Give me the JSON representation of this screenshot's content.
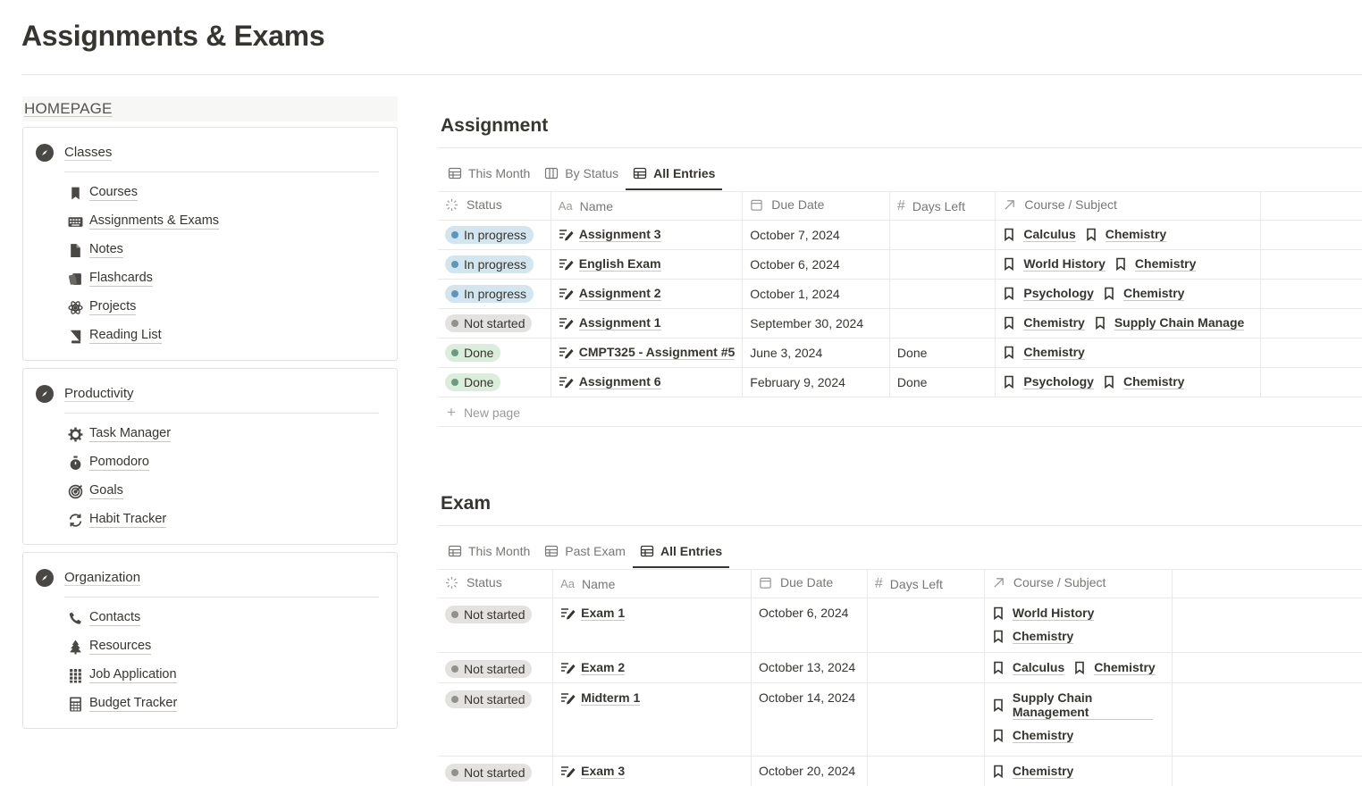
{
  "page": {
    "title": "Assignments & Exams"
  },
  "sidebar": {
    "homepage_label": "HOMEPAGE",
    "sections": [
      {
        "title": "Classes",
        "items": [
          {
            "label": "Courses",
            "icon": "bookmark-icon"
          },
          {
            "label": "Assignments & Exams",
            "icon": "keyboard-icon"
          },
          {
            "label": "Notes",
            "icon": "document-icon"
          },
          {
            "label": "Flashcards",
            "icon": "cards-icon"
          },
          {
            "label": "Projects",
            "icon": "atom-icon"
          },
          {
            "label": "Reading List",
            "icon": "book-icon"
          }
        ]
      },
      {
        "title": "Productivity",
        "items": [
          {
            "label": "Task Manager",
            "icon": "gear-icon"
          },
          {
            "label": "Pomodoro",
            "icon": "stopwatch-icon"
          },
          {
            "label": "Goals",
            "icon": "target-icon"
          },
          {
            "label": "Habit Tracker",
            "icon": "refresh-icon"
          }
        ]
      },
      {
        "title": "Organization",
        "items": [
          {
            "label": "Contacts",
            "icon": "phone-icon"
          },
          {
            "label": "Resources",
            "icon": "tree-icon"
          },
          {
            "label": "Job Application",
            "icon": "grid-icon"
          },
          {
            "label": "Budget Tracker",
            "icon": "calculator-icon"
          }
        ]
      }
    ]
  },
  "assignment": {
    "title": "Assignment",
    "tabs": [
      "This Month",
      "By Status",
      "All Entries"
    ],
    "active_tab": "All Entries",
    "columns": [
      "Status",
      "Name",
      "Due Date",
      "Days Left",
      "Course / Subject"
    ],
    "rows": [
      {
        "status": "In progress",
        "name": "Assignment 3",
        "due": "October 7, 2024",
        "days_left": "",
        "courses": [
          "Calculus",
          "Chemistry"
        ]
      },
      {
        "status": "In progress",
        "name": "English Exam",
        "due": "October 6, 2024",
        "days_left": "",
        "courses": [
          "World History",
          "Chemistry"
        ]
      },
      {
        "status": "In progress",
        "name": "Assignment 2",
        "due": "October 1, 2024",
        "days_left": "",
        "courses": [
          "Psychology",
          "Chemistry"
        ]
      },
      {
        "status": "Not started",
        "name": "Assignment 1",
        "due": "September 30, 2024",
        "days_left": "",
        "courses": [
          "Chemistry",
          "Supply Chain Manage"
        ]
      },
      {
        "status": "Done",
        "name": "CMPT325 - Assignment #5",
        "due": "June 3, 2024",
        "days_left": "Done",
        "courses": [
          "Chemistry"
        ]
      },
      {
        "status": "Done",
        "name": "Assignment 6",
        "due": "February 9, 2024",
        "days_left": "Done",
        "courses": [
          "Psychology",
          "Chemistry"
        ]
      }
    ],
    "new_page_label": "New page"
  },
  "exam": {
    "title": "Exam",
    "tabs": [
      "This Month",
      "Past Exam",
      "All Entries"
    ],
    "active_tab": "All Entries",
    "columns": [
      "Status",
      "Name",
      "Due Date",
      "Days Left",
      "Course / Subject"
    ],
    "rows": [
      {
        "status": "Not started",
        "name": "Exam 1",
        "due": "October 6, 2024",
        "days_left": "",
        "courses": [
          "World History",
          "Chemistry"
        ]
      },
      {
        "status": "Not started",
        "name": "Exam 2",
        "due": "October 13, 2024",
        "days_left": "",
        "courses": [
          "Calculus",
          "Chemistry"
        ]
      },
      {
        "status": "Not started",
        "name": "Midterm 1",
        "due": "October 14, 2024",
        "days_left": "",
        "courses": [
          "Supply Chain Management",
          "Chemistry"
        ]
      },
      {
        "status": "Not started",
        "name": "Exam 3",
        "due": "October 20, 2024",
        "days_left": "",
        "courses": [
          "Chemistry"
        ]
      }
    ]
  },
  "colors": {
    "in_progress_bg": "#d3e5ef",
    "in_progress_dot": "#5b97bd",
    "not_started_bg": "#e3e2e0",
    "not_started_dot": "#91918e",
    "done_bg": "#dbeddb",
    "done_dot": "#6c9b7d"
  }
}
